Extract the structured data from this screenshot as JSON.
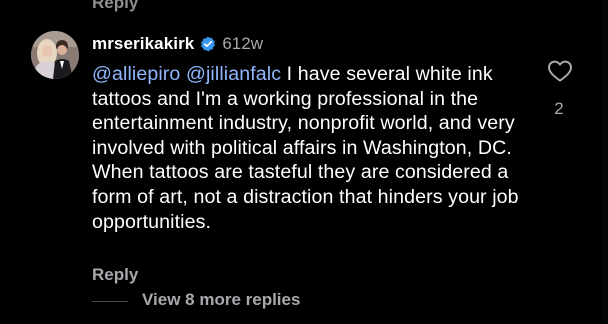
{
  "previous_comment": {
    "reply_label": "Reply"
  },
  "comment": {
    "username": "mrserikakirk",
    "verified_icon": "verified-badge-icon",
    "timestamp": "612w",
    "mention_1": "@alliepiro",
    "mention_2": "@jillianfalc",
    "body": "I have several white ink tattoos and I'm a working professional in the entertainment industry, nonprofit world, and very involved with political affairs in Washington, DC. When tattoos are tasteful they are considered a form of art, not a distraction that hinders your job opportunities.",
    "like_icon": "heart-outline-icon",
    "like_count": "2",
    "reply_label": "Reply",
    "view_more_label": "View 8 more replies"
  },
  "colors": {
    "background": "#000000",
    "text": "#ffffff",
    "secondary": "#a8a8ad",
    "mention": "#8fb6ff",
    "verified": "#3897f0"
  }
}
